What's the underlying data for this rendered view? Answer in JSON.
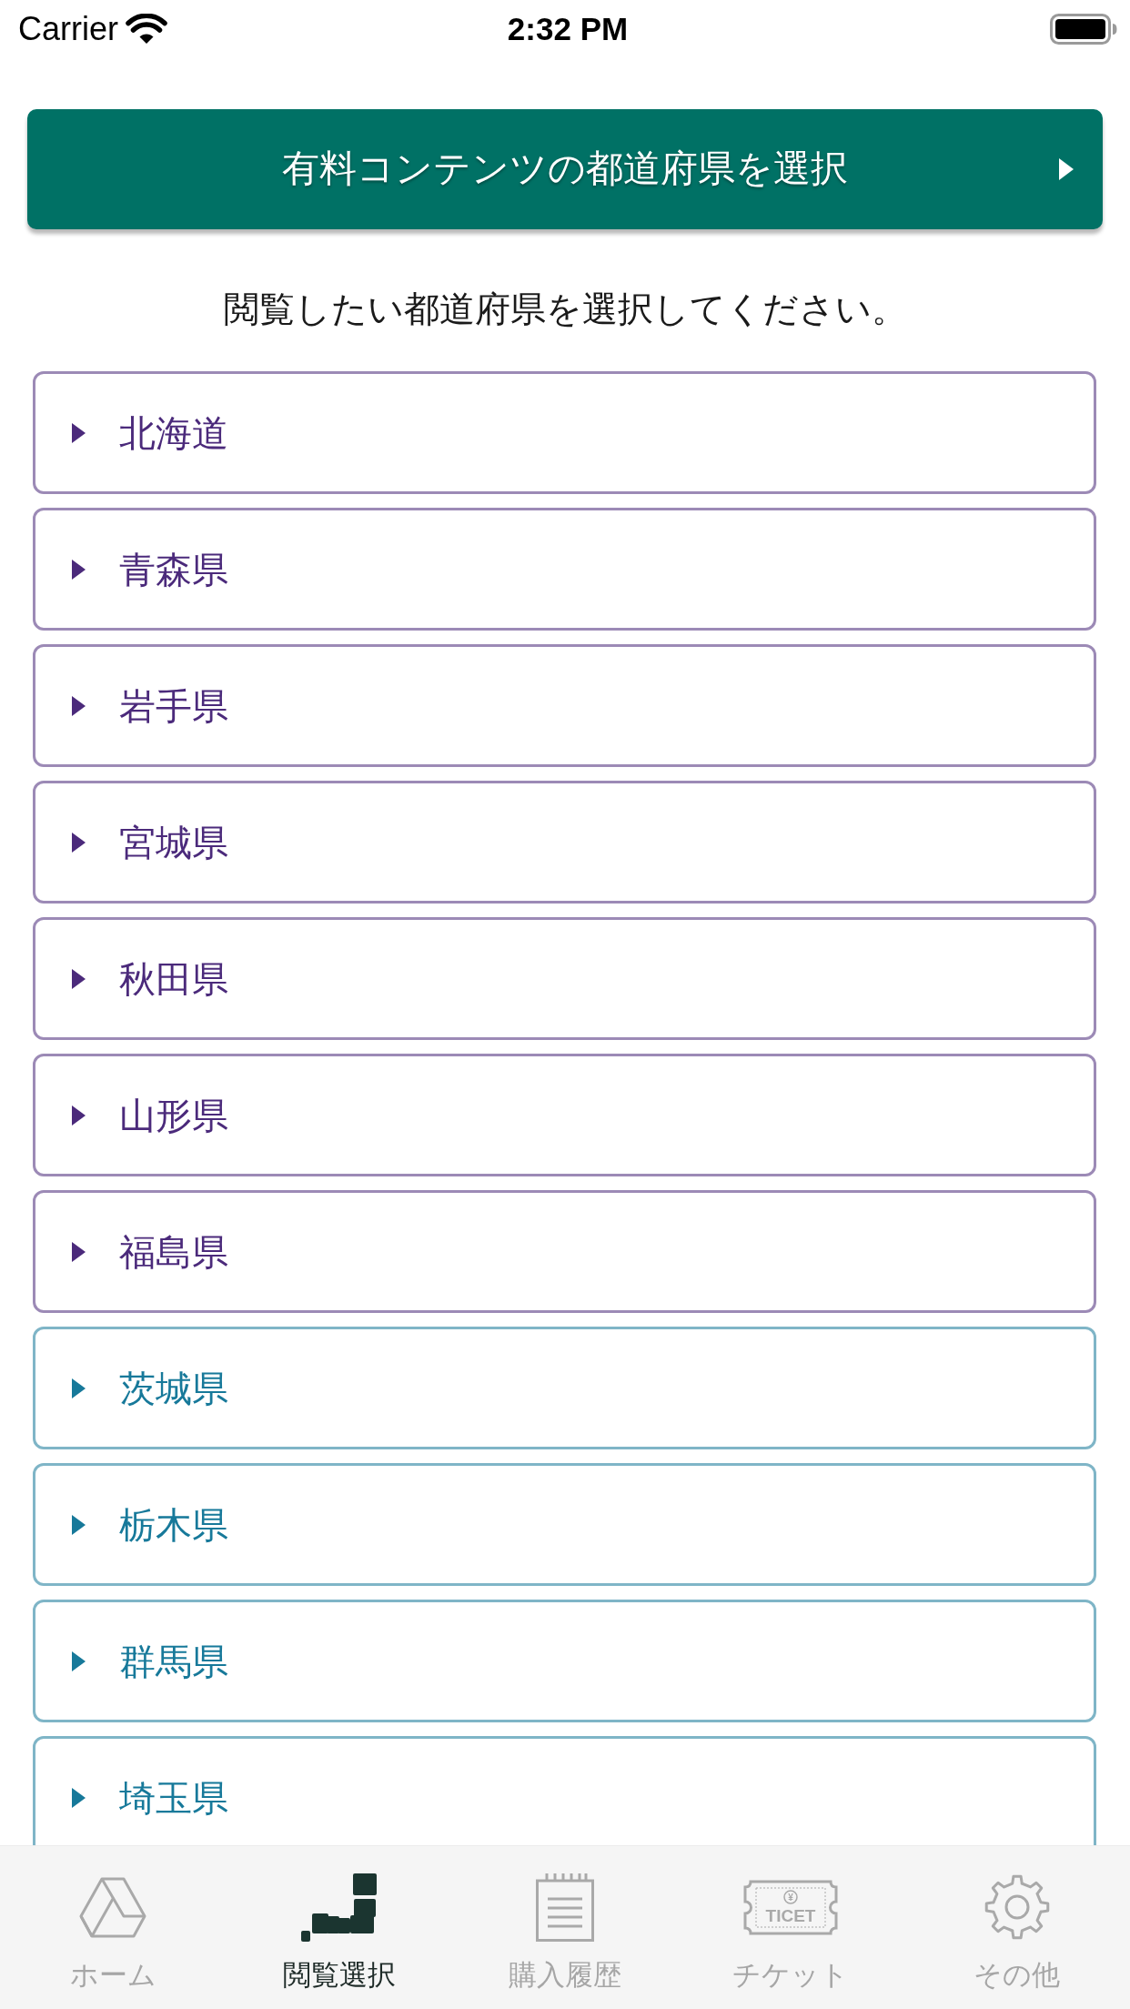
{
  "status_bar": {
    "carrier": "Carrier",
    "time": "2:32 PM"
  },
  "header_button": {
    "label": "有料コンテンツの都道府県を選択"
  },
  "instruction": "閲覧したい都道府県を選択してください。",
  "prefectures": [
    {
      "name": "北海道",
      "color": "#4b2a7b"
    },
    {
      "name": "青森県",
      "color": "#4b2a7b"
    },
    {
      "name": "岩手県",
      "color": "#4b2a7b"
    },
    {
      "name": "宮城県",
      "color": "#4b2a7b"
    },
    {
      "name": "秋田県",
      "color": "#4b2a7b"
    },
    {
      "name": "山形県",
      "color": "#4b2a7b"
    },
    {
      "name": "福島県",
      "color": "#4b2a7b"
    },
    {
      "name": "茨城県",
      "color": "#17799a"
    },
    {
      "name": "栃木県",
      "color": "#17799a"
    },
    {
      "name": "群馬県",
      "color": "#17799a"
    },
    {
      "name": "埼玉県",
      "color": "#17799a"
    }
  ],
  "tab_bar": {
    "tabs": [
      {
        "kind": "home",
        "label": "ホーム",
        "selected": false
      },
      {
        "kind": "map",
        "label": "閲覧選択",
        "selected": true
      },
      {
        "kind": "history",
        "label": "購入履歴",
        "selected": false
      },
      {
        "kind": "ticket",
        "label": "チケット",
        "selected": false,
        "icon_symbol": "¥",
        "icon_text": "TICET"
      },
      {
        "kind": "settings",
        "label": "その他",
        "selected": false
      }
    ]
  }
}
